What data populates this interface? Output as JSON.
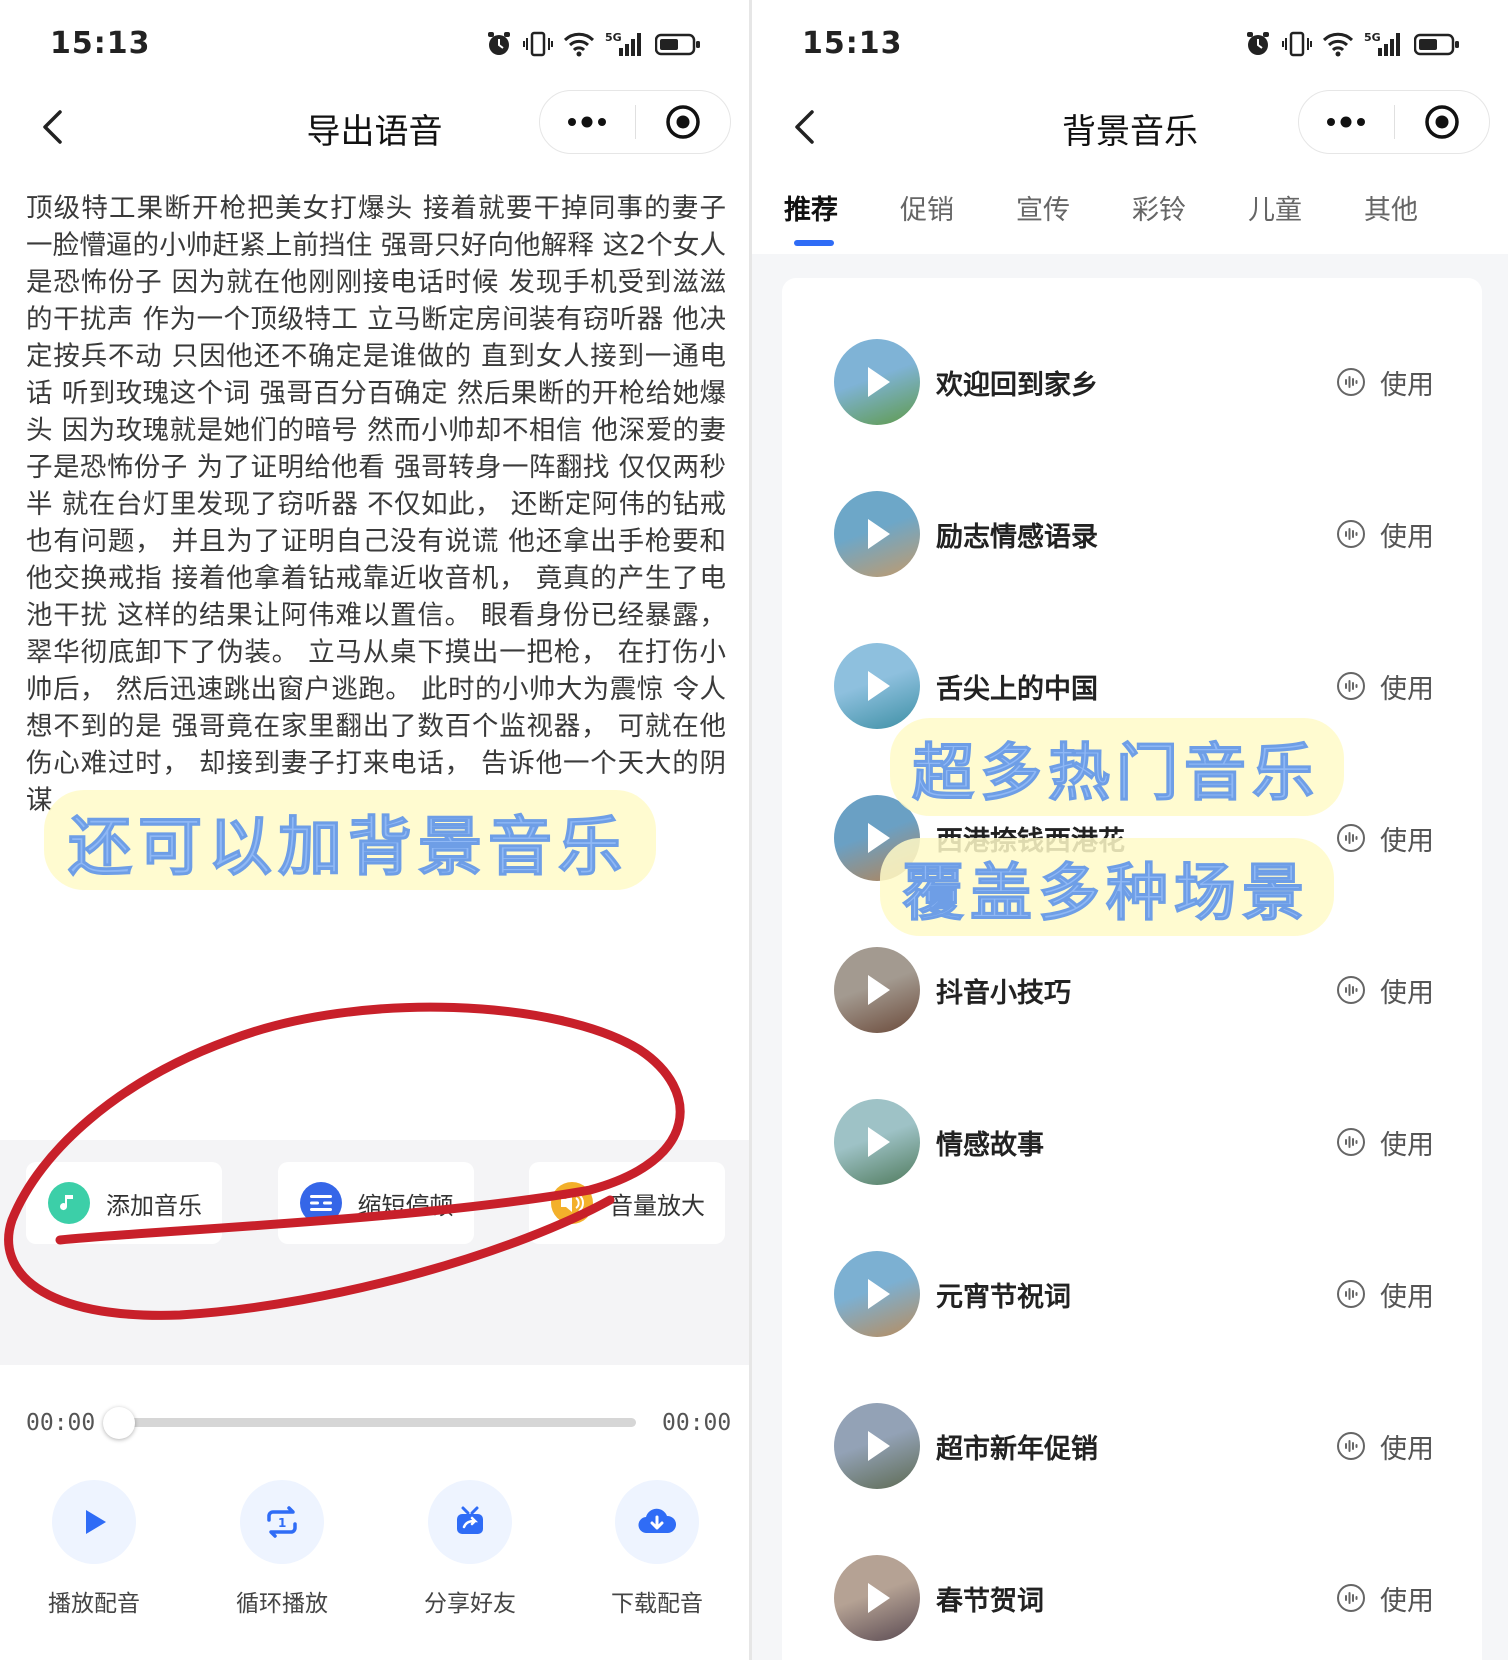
{
  "status": {
    "time": "15:13"
  },
  "left": {
    "title": "导出语音",
    "script_text": "顶级特工果断开枪把美女打爆头 接着就要干掉同事的妻子 一脸懵逼的小帅赶紧上前挡住 强哥只好向他解释 这2个女人是恐怖份子 因为就在他刚刚接电话时候 发现手机受到滋滋的干扰声 作为一个顶级特工 立马断定房间装有窃听器 他决定按兵不动 只因他还不确定是谁做的 直到女人接到一通电话 听到玫瑰这个词 强哥百分百确定 然后果断的开枪给她爆头 因为玫瑰就是她们的暗号 然而小帅却不相信 他深爱的妻子是恐怖份子 为了证明给他看 强哥转身一阵翻找 仅仅两秒半 就在台灯里发现了窃听器 不仅如此， 还断定阿伟的钻戒也有问题， 并且为了证明自己没有说谎 他还拿出手枪要和他交换戒指 接着他拿着钻戒靠近收音机， 竟真的产生了电池干扰 这样的结果让阿伟难以置信。 眼看身份已经暴露， 翠华彻底卸下了伪装。 立马从桌下摸出一把枪， 在打伤小帅后， 然后迅速跳出窗户逃跑。 此时的小帅大为震惊 令人想不到的是 强哥竟在家里翻出了数百个监视器， 可就在他伤心难过时， 却接到妻子打来电话， 告诉他一个天大的阴谋",
    "annotation": "还可以加背景音乐",
    "tools": [
      {
        "label": "添加音乐",
        "icon": "music-note-icon",
        "color": "#3ccfa8"
      },
      {
        "label": "缩短停顿",
        "icon": "pause-shorten-icon",
        "color": "#3566e8"
      },
      {
        "label": "音量放大",
        "icon": "volume-icon",
        "color": "#f3b02b"
      }
    ],
    "player": {
      "current_time": "00:00",
      "total_time": "00:00",
      "progress": 0,
      "buttons": [
        {
          "label": "播放配音",
          "icon": "play-icon"
        },
        {
          "label": "循环播放",
          "icon": "loop-icon"
        },
        {
          "label": "分享好友",
          "icon": "share-icon"
        },
        {
          "label": "下载配音",
          "icon": "download-icon"
        }
      ]
    }
  },
  "right": {
    "title": "背景音乐",
    "tabs": [
      "推荐",
      "促销",
      "宣传",
      "彩铃",
      "儿童",
      "其他"
    ],
    "active_tab": 0,
    "annotation_line1": "超多热门音乐",
    "annotation_line2": "覆盖多种场景",
    "use_label": "使用",
    "tracks": [
      {
        "name": "欢迎回到家乡",
        "colors": [
          "#7fb3d6",
          "#5f9a4a"
        ]
      },
      {
        "name": "励志情感语录",
        "colors": [
          "#6da7c8",
          "#c29a6b"
        ]
      },
      {
        "name": "舌尖上的中国",
        "colors": [
          "#8ec0de",
          "#3d8fa4"
        ]
      },
      {
        "name": "西港捺钱西港花",
        "colors": [
          "#6aa0c4",
          "#b48456"
        ]
      },
      {
        "name": "抖音小技巧",
        "colors": [
          "#a39a90",
          "#6b4a3a"
        ]
      },
      {
        "name": "情感故事",
        "colors": [
          "#9ec2c6",
          "#4f7a5c"
        ]
      },
      {
        "name": "元宵节祝词",
        "colors": [
          "#7cb0d2",
          "#b98c5c"
        ]
      },
      {
        "name": "超市新年促销",
        "colors": [
          "#93a2b6",
          "#5d6a52"
        ]
      },
      {
        "name": "春节贺词",
        "colors": [
          "#b5a294",
          "#5a4a52"
        ]
      }
    ]
  }
}
